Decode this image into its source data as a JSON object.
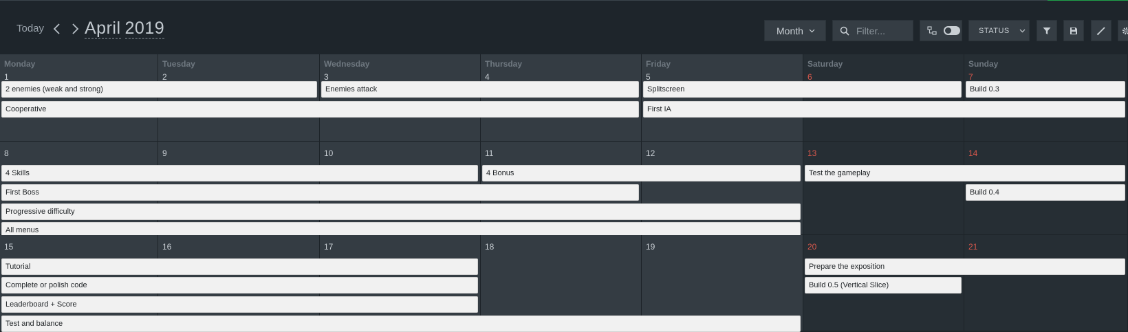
{
  "toolbar": {
    "today_label": "Today",
    "month_label": "April",
    "year_label": "2019",
    "view_label": "Month",
    "filter_placeholder": "Filter...",
    "status_label": "STATUS"
  },
  "day_names": [
    "Monday",
    "Tuesday",
    "Wednesday",
    "Thursday",
    "Friday",
    "Saturday",
    "Sunday"
  ],
  "weeks": [
    {
      "days": [
        "1",
        "2",
        "3",
        "4",
        "5",
        "6",
        "7"
      ],
      "events": [
        {
          "title": "2 enemies (weak and strong)",
          "start": 0,
          "end": 1,
          "row": 0
        },
        {
          "title": "Enemies attack",
          "start": 2,
          "end": 3,
          "row": 0
        },
        {
          "title": "Splitscreen",
          "start": 4,
          "end": 5,
          "row": 0
        },
        {
          "title": "Build 0.3",
          "start": 6,
          "end": 6,
          "row": 0
        },
        {
          "title": "Cooperative",
          "start": 0,
          "end": 3,
          "row": 1
        },
        {
          "title": "First IA",
          "start": 4,
          "end": 6,
          "row": 1
        }
      ]
    },
    {
      "days": [
        "8",
        "9",
        "10",
        "11",
        "12",
        "13",
        "14"
      ],
      "events": [
        {
          "title": "4 Skills",
          "start": 0,
          "end": 2,
          "row": 0
        },
        {
          "title": "4 Bonus",
          "start": 3,
          "end": 4,
          "row": 0
        },
        {
          "title": "Test the gameplay",
          "start": 5,
          "end": 6,
          "row": 0
        },
        {
          "title": "First Boss",
          "start": 0,
          "end": 3,
          "row": 1
        },
        {
          "title": "Build 0.4",
          "start": 6,
          "end": 6,
          "row": 1
        },
        {
          "title": "Progressive difficulty",
          "start": 0,
          "end": 4,
          "row": 2
        },
        {
          "title": "All menus",
          "start": 0,
          "end": 4,
          "row": 3
        }
      ]
    },
    {
      "days": [
        "15",
        "16",
        "17",
        "18",
        "19",
        "20",
        "21"
      ],
      "events": [
        {
          "title": "Tutorial",
          "start": 0,
          "end": 2,
          "row": 0
        },
        {
          "title": "Prepare the exposition",
          "start": 5,
          "end": 6,
          "row": 0
        },
        {
          "title": "Complete or polish code",
          "start": 0,
          "end": 2,
          "row": 1
        },
        {
          "title": "Build 0.5 (Vertical Slice)",
          "start": 5,
          "end": 5,
          "row": 1
        },
        {
          "title": "Leaderboard + Score",
          "start": 0,
          "end": 2,
          "row": 2
        },
        {
          "title": "Test and balance",
          "start": 0,
          "end": 4,
          "row": 3
        }
      ]
    }
  ]
}
